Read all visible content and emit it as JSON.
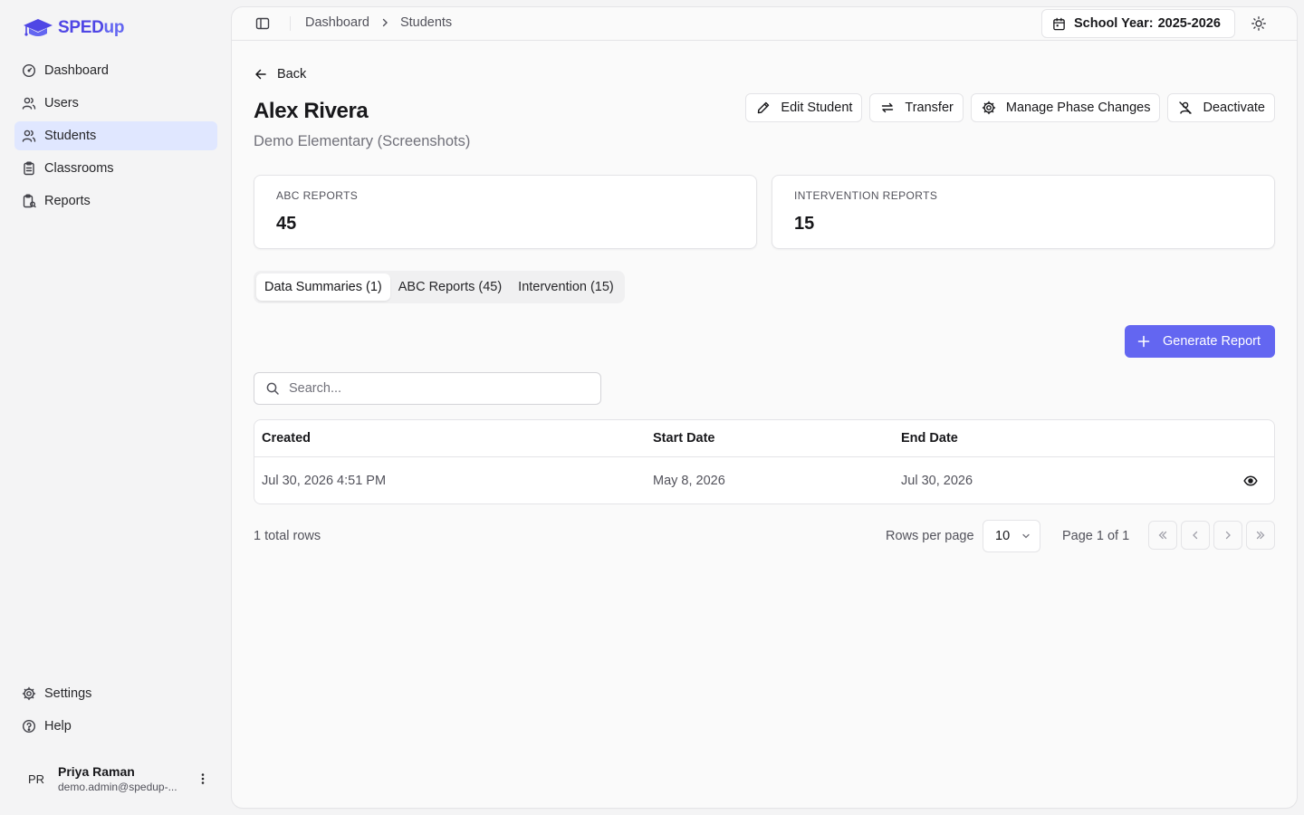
{
  "app": {
    "logo_text_main": "SPED",
    "logo_text_accent": "up",
    "brand_color": "#4f46e5",
    "accent_color": "#6366f1"
  },
  "sidebar": {
    "items": [
      {
        "label": "Dashboard",
        "icon": "gauge-icon"
      },
      {
        "label": "Users",
        "icon": "users-icon"
      },
      {
        "label": "Students",
        "icon": "users-icon",
        "active": true
      },
      {
        "label": "Classrooms",
        "icon": "clipboard-icon"
      },
      {
        "label": "Reports",
        "icon": "report-icon"
      }
    ],
    "bottom_items": [
      {
        "label": "Settings",
        "icon": "gear-icon"
      },
      {
        "label": "Help",
        "icon": "help-circle-icon"
      }
    ],
    "user": {
      "initials": "PR",
      "name": "Priya Raman",
      "email": "demo.admin@spedup-..."
    }
  },
  "topbar": {
    "breadcrumb": [
      "Dashboard",
      "Students"
    ],
    "school_year_label": "School Year:",
    "school_year_value": "2025-2026"
  },
  "student": {
    "back_label": "Back",
    "name": "Alex Rivera",
    "school": "Demo Elementary (Screenshots)"
  },
  "actions": {
    "edit": "Edit Student",
    "transfer": "Transfer",
    "phase": "Manage Phase Changes",
    "deactivate": "Deactivate"
  },
  "stats": {
    "abc_label": "ABC REPORTS",
    "abc_value": "45",
    "intervention_label": "INTERVENTION REPORTS",
    "intervention_value": "15"
  },
  "tabs": [
    {
      "label": "Data Summaries (1)",
      "active": true
    },
    {
      "label": "ABC Reports (45)",
      "active": false
    },
    {
      "label": "Intervention (15)",
      "active": false
    }
  ],
  "generate_label": "Generate Report",
  "search": {
    "placeholder": "Search..."
  },
  "table": {
    "columns": [
      "Created",
      "Start Date",
      "End Date"
    ],
    "rows": [
      {
        "created": "Jul 30, 2026 4:51 PM",
        "start": "May 8, 2026",
        "end": "Jul 30, 2026"
      }
    ]
  },
  "pagination": {
    "total": "1 total rows",
    "rows_per_page_label": "Rows per page",
    "rows_per_page_value": "10",
    "page_info": "Page 1 of 1"
  }
}
